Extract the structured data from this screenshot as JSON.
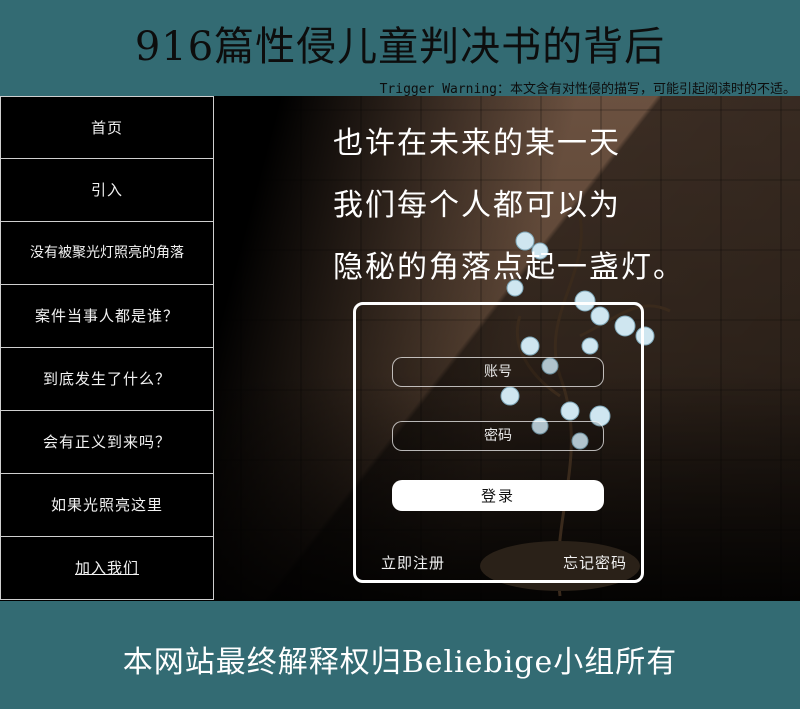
{
  "header": {
    "title": "916篇性侵儿童判决书的背后",
    "warning": "Trigger Warning：本文含有对性侵的描写，可能引起阅读时的不适。"
  },
  "sidebar": {
    "items": [
      {
        "label": "首页"
      },
      {
        "label": "引入"
      },
      {
        "label": "没有被聚光灯照亮的角落"
      },
      {
        "label": "案件当事人都是谁？"
      },
      {
        "label": "到底发生了什么？"
      },
      {
        "label": "会有正义到来吗？"
      },
      {
        "label": "如果光照亮这里"
      },
      {
        "label": "加入我们"
      }
    ]
  },
  "hero": {
    "lines": [
      "也许在未来的某一天",
      "我们每个人都可以为",
      "隐秘的角落点起一盏灯。"
    ]
  },
  "login": {
    "account_placeholder": "账号",
    "password_placeholder": "密码",
    "submit_label": "登录",
    "register_label": "立即注册",
    "forgot_label": "忘记密码"
  },
  "footer": {
    "text": "本网站最终解释权归Beliebige小组所有"
  },
  "colors": {
    "band": "#336b73",
    "panel": "#000000",
    "text_light": "#ffffff",
    "title_dark": "#0d0d0d"
  }
}
